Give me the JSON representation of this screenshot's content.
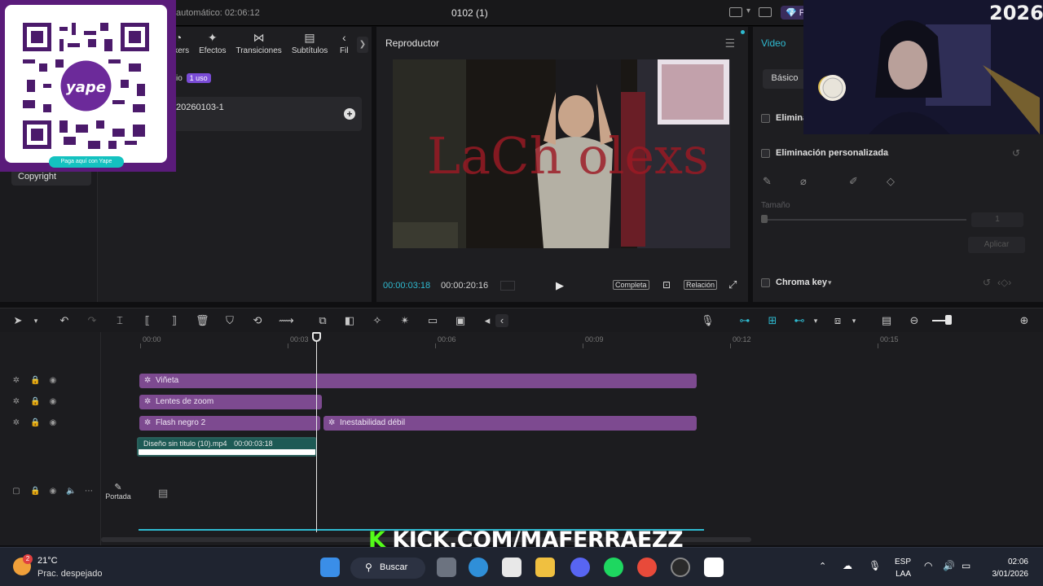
{
  "titlebar": {
    "autosave": "automático: 02:06:12",
    "project": "0102 (1)",
    "pro": "Pr"
  },
  "media": {
    "tabs": [
      {
        "label": "ickers",
        "icon": "sticker-icon"
      },
      {
        "label": "Efectos",
        "icon": "effects-icon"
      },
      {
        "label": "Transiciones",
        "icon": "transitions-icon"
      },
      {
        "label": "Subtítulos",
        "icon": "subtitles-icon"
      },
      {
        "label": "Fil",
        "icon": "filters-icon"
      }
    ],
    "uso_prefix": "io",
    "uso_badge": "1 uso",
    "item_name": "20260103-1",
    "copyright": "Copyright"
  },
  "qr": {
    "pill_text": "Paga aquí con Yape",
    "logo_text": "yape"
  },
  "player": {
    "title": "Reproductor",
    "time_current": "00:00:03:18",
    "time_total": "00:00:20:16",
    "btn_full": "Completa",
    "btn_ratio": "Relación",
    "watermark": "LaCh  olexs"
  },
  "props": {
    "tab": "Video",
    "basico": "Básico",
    "remove_bg": "Elimina",
    "custom_removal": "Eliminación personalizada",
    "size_label": "Tamaño",
    "size_value": "1",
    "apply": "Aplicar",
    "chroma": "Chroma key"
  },
  "webcam": {
    "year": "2026"
  },
  "timeline": {
    "ruler": [
      "00:00",
      "00:03",
      "00:06",
      "00:09",
      "00:12",
      "00:15"
    ],
    "clips": [
      {
        "label": "Viñeta"
      },
      {
        "label": "Lentes de zoom"
      },
      {
        "label": "Flash negro 2"
      },
      {
        "label": "Inestabilidad débil"
      }
    ],
    "main_clip_name": "Diseño sin título (10).mp4",
    "main_clip_duration": "00:00:03:18",
    "portada": "Portada"
  },
  "overlay": {
    "kick_k": "K",
    "kick_url": "KICK.COM/MAFERRAEZZ"
  },
  "taskbar": {
    "temp": "21°C",
    "weather": "Prac. despejado",
    "weather_badge": "2",
    "search": "Buscar",
    "lang1": "ESP",
    "lang2": "LAA",
    "time": "02:06",
    "date": "3/01/2026"
  }
}
